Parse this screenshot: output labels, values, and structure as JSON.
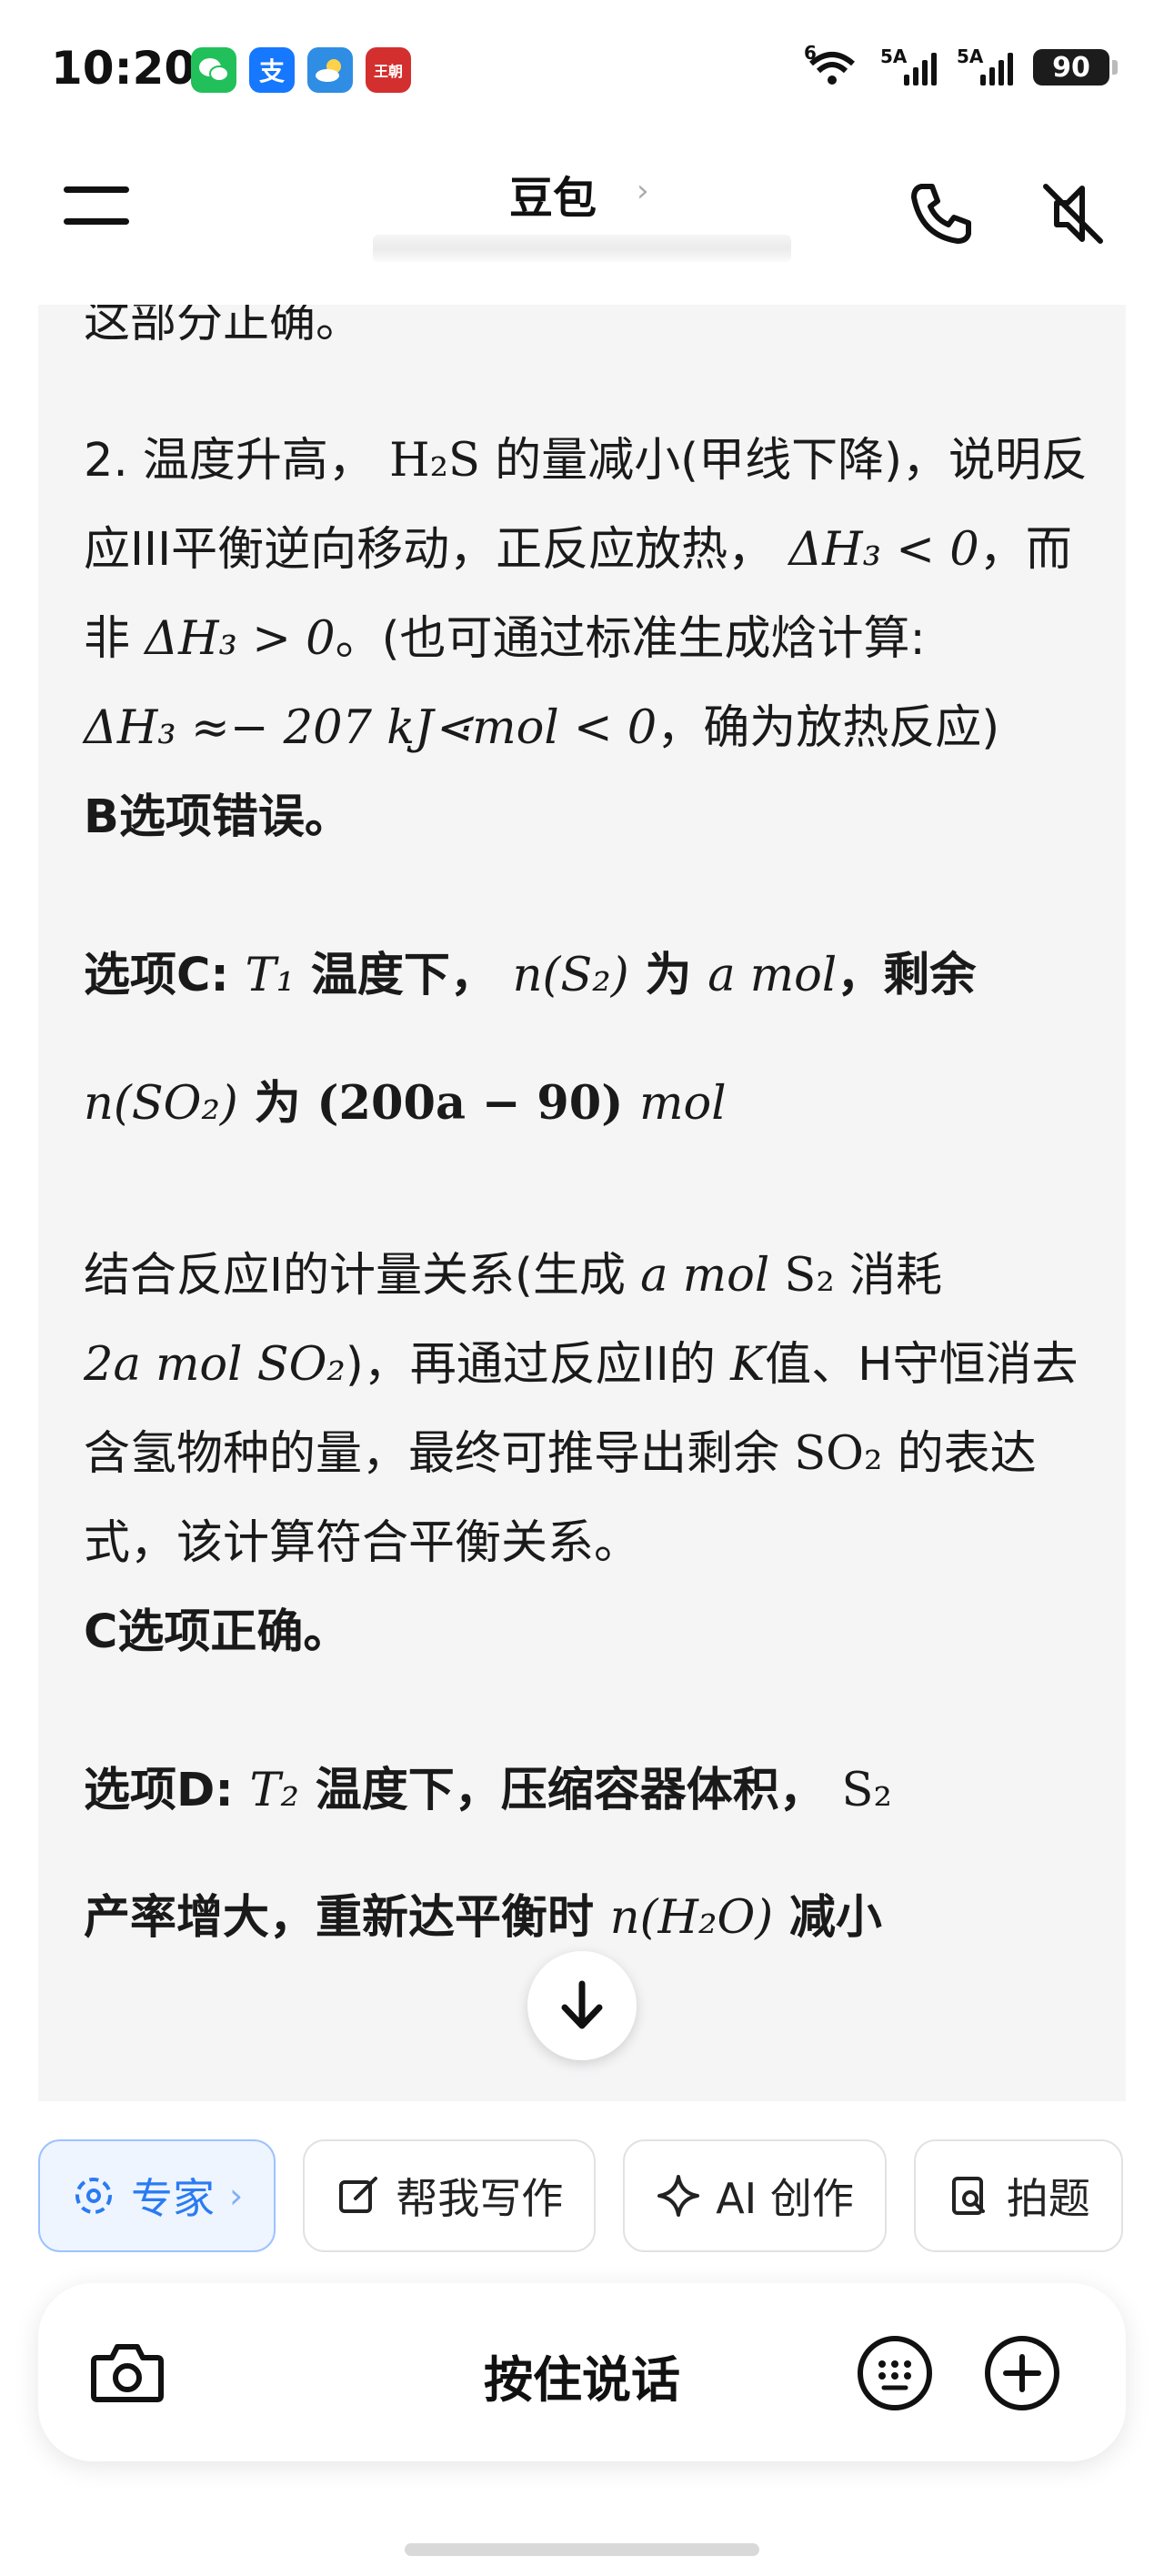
{
  "status_bar": {
    "time": "10:20",
    "app_icons": [
      "wechat-icon",
      "alipay-icon",
      "weather-icon",
      "wangchao-icon"
    ],
    "alipay_glyph": "支",
    "wang_glyph": "王朝",
    "wifi_label": "6",
    "sim1_label": "5A",
    "sim2_label": "5A",
    "battery": "90"
  },
  "header": {
    "title": "豆包",
    "title_chevron": "›"
  },
  "message": {
    "cut_line": "这部分正确。",
    "p2": {
      "a": "2. 温度升高，",
      "h2s": "H₂S",
      "b": "的量减小(甲线下降)，说明反应III平衡逆向移动，正反应放热，",
      "dh3_lt": "ΔH₃ < 0",
      "c": "，而非",
      "dh3_gt": "ΔH₃ > 0",
      "d": "。(也可通过标准生成焓计算:",
      "calc": "ΔH₃ ≈− 207 kJ⋖mol < 0",
      "e": "，确为放热反应)"
    },
    "b_wrong": "B选项错误。",
    "c_option": {
      "label": "选项C:",
      "t1": "T₁",
      "temp": "温度下，",
      "ns2": "n(S₂)",
      "wei": "为",
      "amol": "a mol",
      "rem": "，剩余",
      "nso2": "n(SO₂)",
      "wei2": "为",
      "expr": "(200a − 90)",
      "mol": "mol"
    },
    "c_explain": {
      "a": "结合反应I的计量关系(生成",
      "amol": "a mol",
      "s2": "S₂",
      "b": "消耗",
      "twoa": "2a mol SO₂",
      "c": ")，再通过反应II的",
      "k": "K",
      "d": "值、H守恒消去含氢物种的量，最终可推导出剩余",
      "so2": "SO₂",
      "e": "的表达式，该计算符合平衡关系。"
    },
    "c_right": "C选项正确。",
    "d_option": {
      "label": "选项D:",
      "t2": "T₂",
      "a": "温度下，压缩容器体积，",
      "s2": "S₂",
      "b": "产率增大，重新达平衡时",
      "nh2o": "n(H₂O)",
      "c": "减小"
    }
  },
  "chips": [
    {
      "label": "专家",
      "icon": "expert-icon"
    },
    {
      "label": "帮我写作",
      "icon": "write-icon"
    },
    {
      "label": "AI 创作",
      "icon": "sparkle-icon"
    },
    {
      "label": "拍题",
      "icon": "photo-question-icon"
    }
  ],
  "input_bar": {
    "hold_to_talk": "按住说话"
  }
}
